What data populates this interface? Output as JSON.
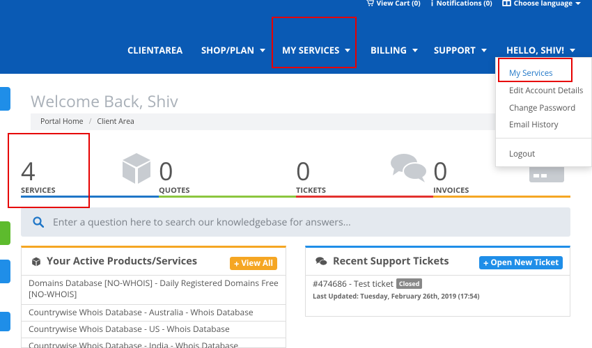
{
  "topbar": {
    "cart": "View Cart (0)",
    "notifications": "Notifications (0)",
    "language": "Choose language"
  },
  "nav": {
    "items": [
      {
        "label": "CLIENTAREA",
        "has_caret": false
      },
      {
        "label": "SHOP/PLAN",
        "has_caret": true
      },
      {
        "label": "MY SERVICES",
        "has_caret": true
      },
      {
        "label": "BILLING",
        "has_caret": true
      },
      {
        "label": "SUPPORT",
        "has_caret": true
      },
      {
        "label": "HELLO, SHIV!",
        "has_caret": true
      }
    ]
  },
  "user_menu": {
    "items": [
      "My Services",
      "Edit Account Details",
      "Change Password",
      "Email History"
    ],
    "logout": "Logout"
  },
  "header": {
    "welcome": "Welcome Back, Shiv",
    "breadcrumb": [
      "Portal Home",
      "Client Area"
    ]
  },
  "stats": [
    {
      "count": "4",
      "label": "SERVICES",
      "color": "#1f76c7"
    },
    {
      "count": "0",
      "label": "QUOTES",
      "color": "#8cc63f"
    },
    {
      "count": "0",
      "label": "TICKETS",
      "color": "#e3312d"
    },
    {
      "count": "0",
      "label": "INVOICES",
      "color": "#f5a623"
    }
  ],
  "search": {
    "placeholder": "Enter a question here to search our knowledgebase for answers..."
  },
  "products_panel": {
    "title": "Your Active Products/Services",
    "button": "View All",
    "items": [
      "Domains Database [NO-WHOIS] - Daily Registered Domains Free [NO-WHOIS]",
      "Countrywise Whois Database - Australia - Whois Database",
      "Countrywise Whois Database - US - Whois Database",
      "Countrywise Whois Database - India - Whois Database"
    ]
  },
  "tickets_panel": {
    "title": "Recent Support Tickets",
    "button": "Open New Ticket",
    "ticket": {
      "title": "#474686 - Test ticket",
      "status": "Closed",
      "updated": "Last Updated: Tuesday, February 26th, 2019 (17:54)"
    }
  },
  "colors": {
    "primary": "#0a5ab4",
    "accent_orange": "#f5a623",
    "accent_blue": "#1f76c7",
    "highlight": "#e60000"
  }
}
